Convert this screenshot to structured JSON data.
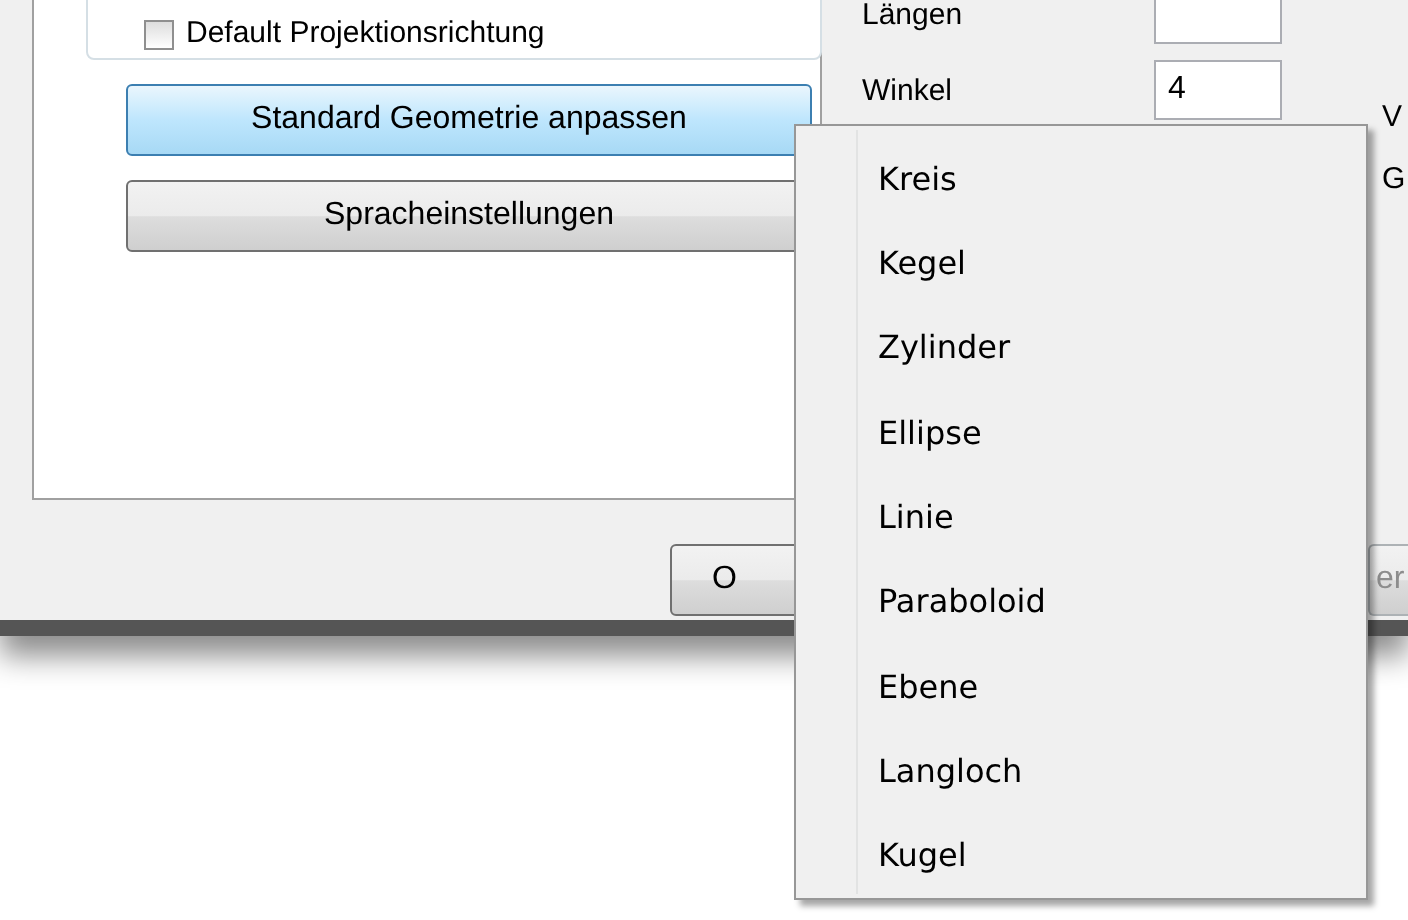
{
  "group_box": {
    "checkbox": {
      "label": "Default Projektionsrichtung",
      "checked": false
    }
  },
  "buttons": [
    {
      "label": "Standard Geometrie anpassen",
      "hover": true
    },
    {
      "label": "Spracheinstellungen",
      "hover": false
    }
  ],
  "fields": [
    {
      "label": "Längen"
    },
    {
      "label": "Winkel",
      "value": "4"
    }
  ],
  "right_labels": [
    "V",
    "G"
  ],
  "footer_buttons": [
    {
      "label": "O",
      "disabled": false
    },
    {
      "label": "er",
      "disabled": true
    }
  ],
  "context_menu": {
    "items": [
      "Kreis",
      "Kegel",
      "Zylinder",
      "Ellipse",
      "Linie",
      "Paraboloid",
      "Ebene",
      "Langloch",
      "Kugel"
    ]
  }
}
